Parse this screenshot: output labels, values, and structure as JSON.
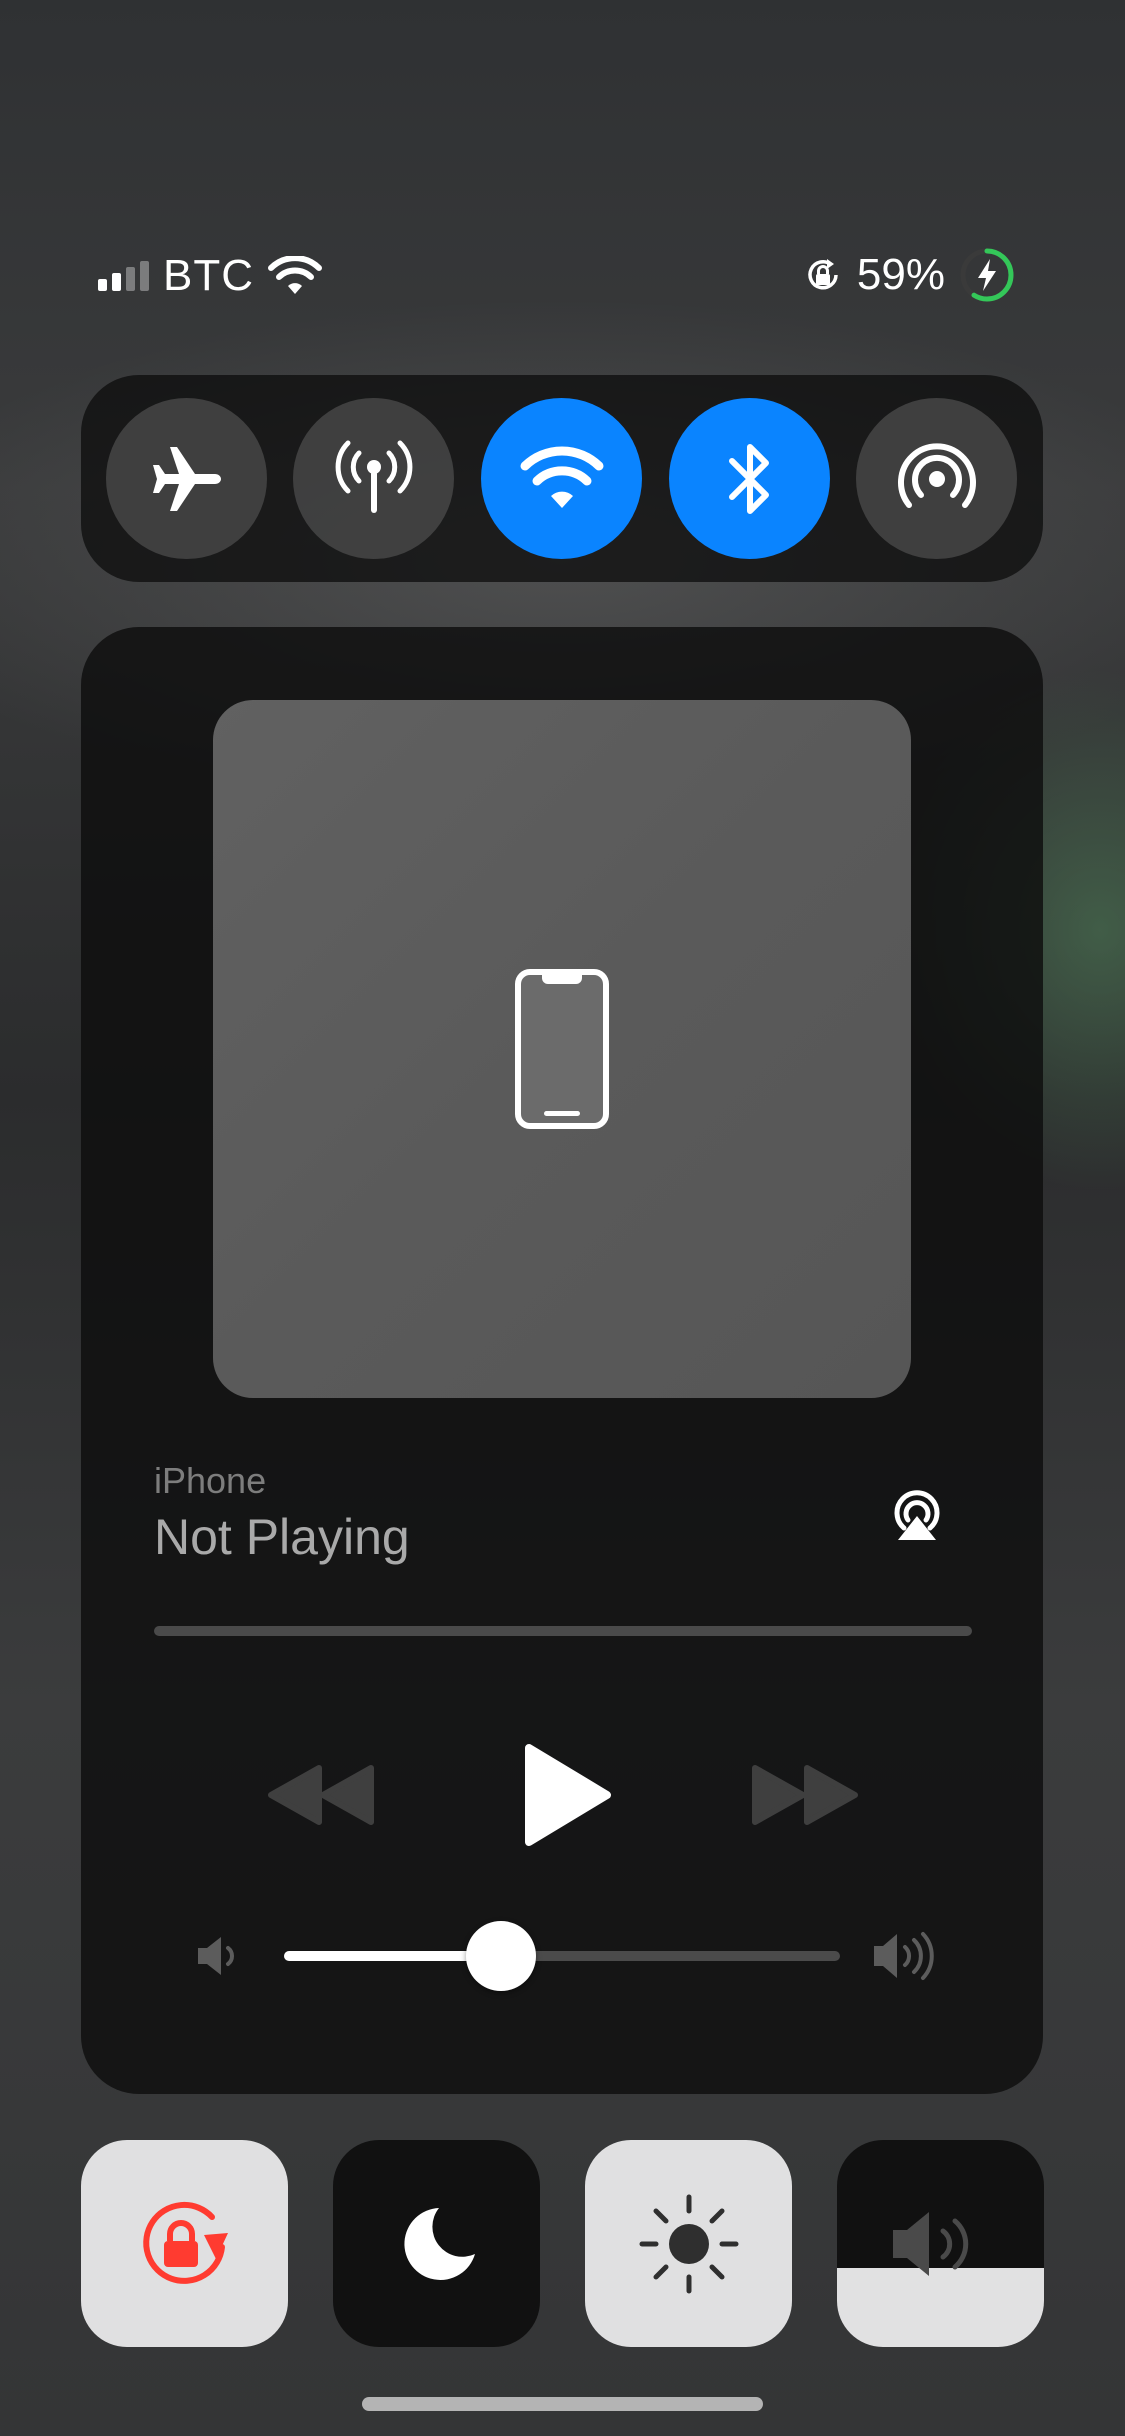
{
  "status_bar": {
    "carrier": "BTC",
    "battery_percent_text": "59%",
    "battery_level": 0.59,
    "signal_bars_active": 2,
    "signal_bars_total": 4,
    "icons": [
      "signal-icon",
      "wifi-icon",
      "orientation-lock-icon",
      "battery-charging-icon"
    ]
  },
  "connectivity": {
    "buttons": [
      {
        "name": "airplane-mode",
        "icon": "airplane-icon",
        "active": false
      },
      {
        "name": "cellular-data",
        "icon": "antenna-icon",
        "active": false
      },
      {
        "name": "wifi",
        "icon": "wifi-icon",
        "active": true
      },
      {
        "name": "bluetooth",
        "icon": "bluetooth-icon",
        "active": true
      },
      {
        "name": "airdrop",
        "icon": "airdrop-icon",
        "active": false
      }
    ],
    "active_color": "#0a84ff"
  },
  "media": {
    "device": "iPhone",
    "title": "Not Playing",
    "artwork_icon": "iphone-icon",
    "volume_level": 0.39,
    "controls": [
      "rewind-icon",
      "play-icon",
      "fast-forward-icon"
    ]
  },
  "tiles": [
    {
      "name": "orientation-lock",
      "icon": "orientation-lock-icon",
      "active": true,
      "accent": "#ff3b30"
    },
    {
      "name": "do-not-disturb",
      "icon": "moon-icon",
      "active": false
    },
    {
      "name": "brightness",
      "icon": "sun-icon",
      "level": 1.0
    },
    {
      "name": "volume",
      "icon": "speaker-icon",
      "level": 0.38
    }
  ],
  "colors": {
    "battery_ring": "#34c759",
    "rotation_lock_red": "#ff3b30"
  }
}
